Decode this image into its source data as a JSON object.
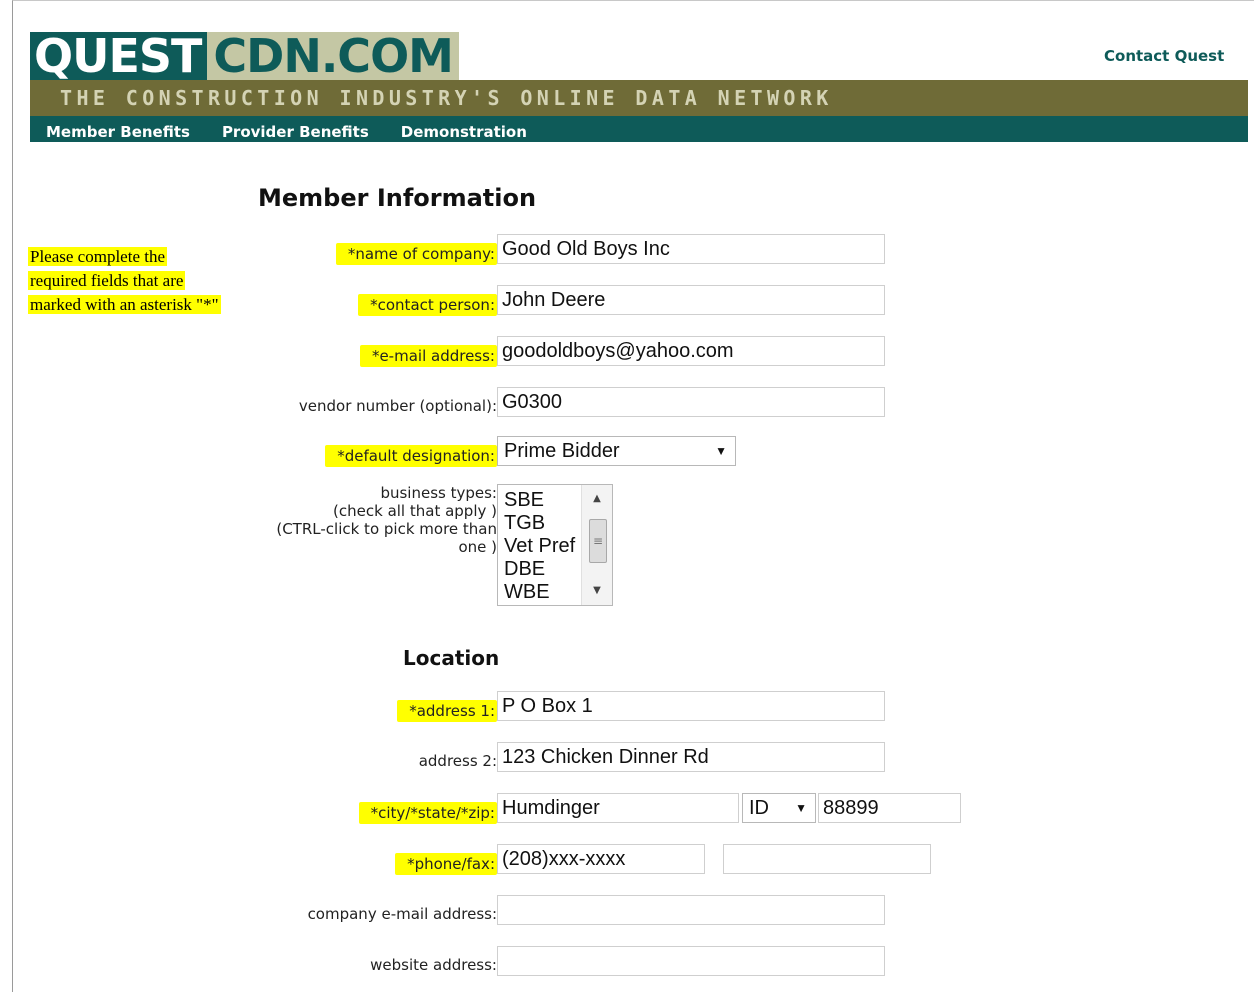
{
  "header": {
    "logo_quest": "QUEST",
    "logo_cdn": "CDN.COM",
    "tagline": "THE CONSTRUCTION INDUSTRY'S ONLINE DATA NETWORK",
    "contact_link": "Contact Quest",
    "nav": [
      "Member Benefits",
      "Provider Benefits",
      "Demonstration"
    ]
  },
  "note": {
    "lines": [
      "Please complete the",
      "required fields that are",
      "marked with an asterisk \"*\""
    ]
  },
  "member": {
    "title": "Member Information",
    "company_label": "*name of company:",
    "company_value": "Good Old Boys Inc",
    "contact_label": "*contact person:",
    "contact_value": "John Deere",
    "email_label": "*e-mail address:",
    "email_value": "goodoldboys@yahoo.com",
    "vendor_label": "vendor number (optional):",
    "vendor_value": "G0300",
    "designation_label": "*default designation:",
    "designation_value": "Prime Bidder",
    "business_types_label": [
      "business types:",
      "(check all that apply )",
      "(CTRL-click to pick more than",
      "one )"
    ],
    "business_types_options": [
      "SBE",
      "TGB",
      "Vet Pref",
      "DBE",
      "WBE"
    ]
  },
  "location": {
    "title": "Location",
    "address1_label": "*address 1:",
    "address1_value": "P O Box 1",
    "address2_label": "address 2:",
    "address2_value": "123 Chicken Dinner Rd",
    "csz_label": "*city/*state/*zip:",
    "city_value": "Humdinger",
    "state_value": "ID",
    "zip_value": "88899",
    "phone_label": "*phone/fax:",
    "phone_value": "(208)xxx-xxxx",
    "fax_value": "",
    "company_email_label": "company e-mail address:",
    "company_email_value": "",
    "website_label": "website address:",
    "website_value": ""
  },
  "colors": {
    "brand_teal": "#0e5b59",
    "brand_olive": "#6f6b37",
    "highlight": "#ffff00"
  },
  "icons": {
    "select_caret": "chevron-down-icon",
    "scroll_up": "arrow-up-icon",
    "scroll_down": "arrow-down-icon"
  }
}
